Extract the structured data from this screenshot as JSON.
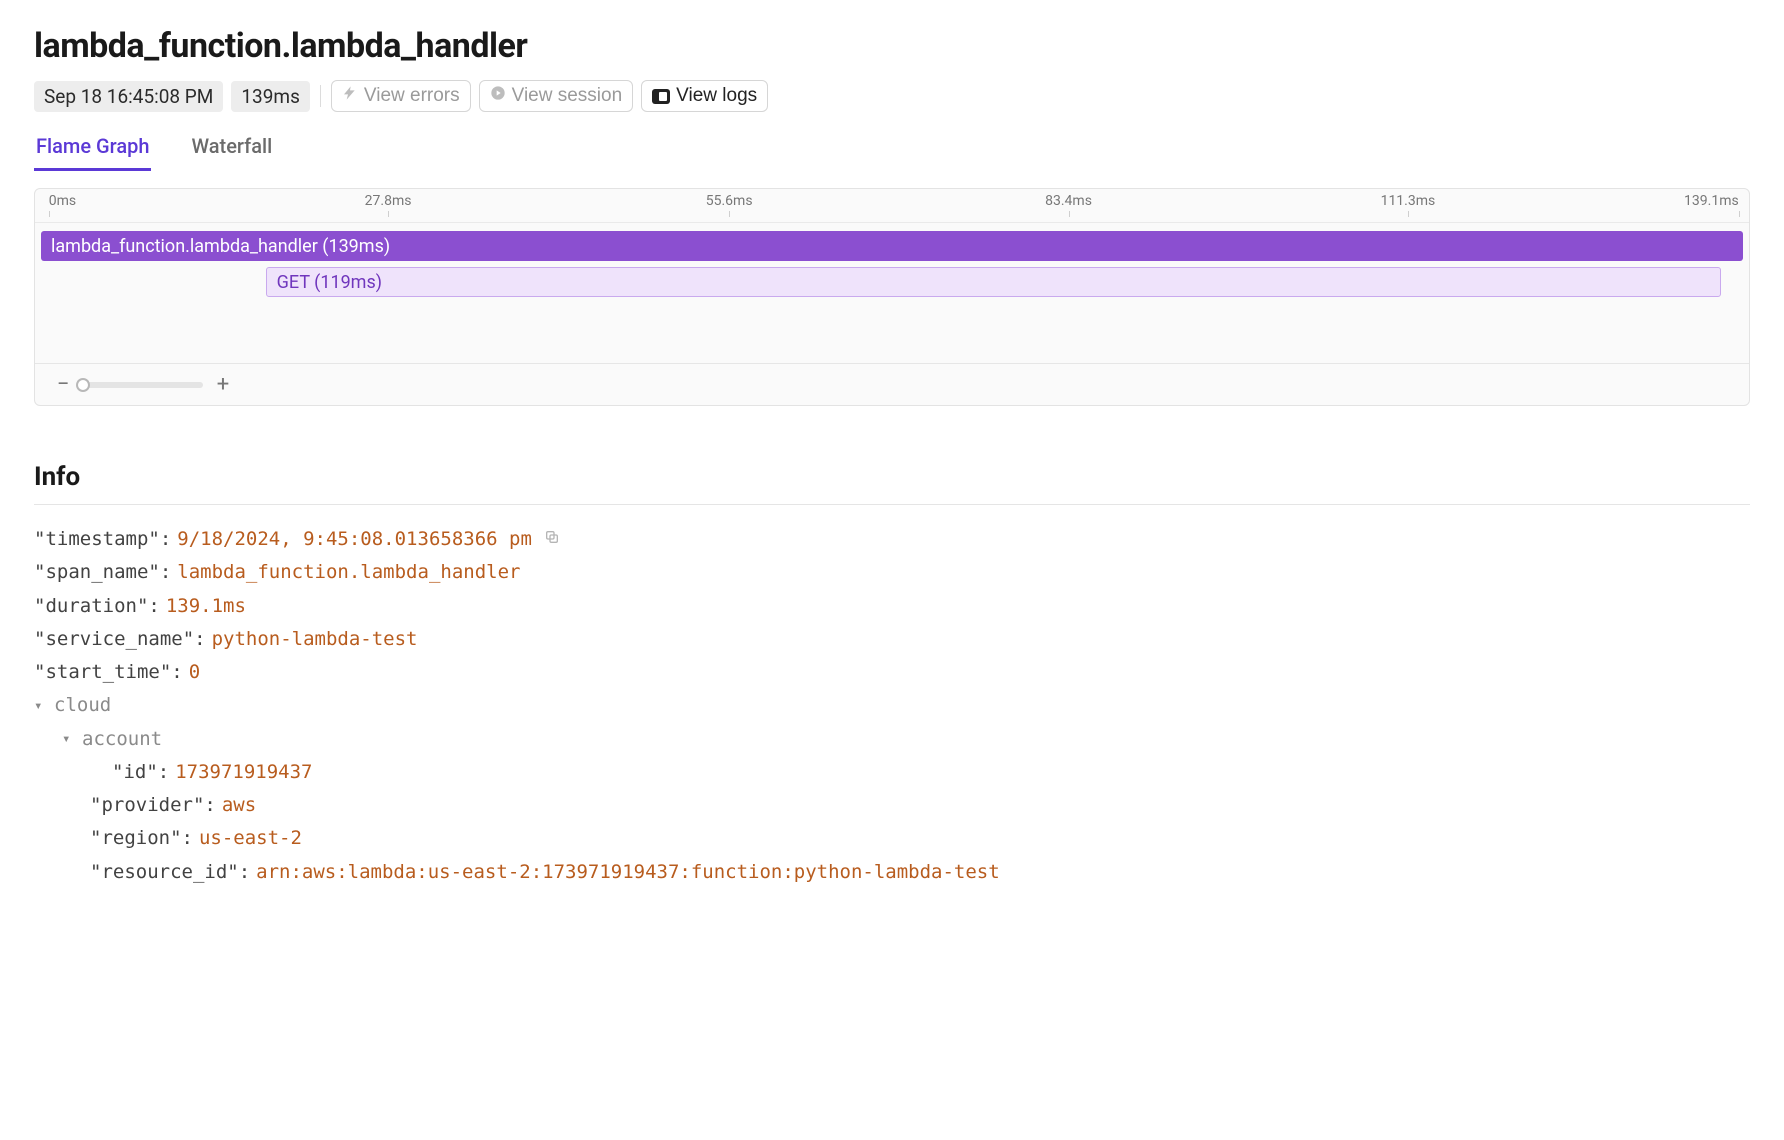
{
  "title": "lambda_function.lambda_handler",
  "header": {
    "timestamp_chip": "Sep 18 16:45:08 PM",
    "duration_chip": "139ms",
    "view_errors": "View errors",
    "view_session": "View session",
    "view_logs": "View logs"
  },
  "tabs": {
    "flame": "Flame Graph",
    "waterfall": "Waterfall"
  },
  "timeline_ticks": [
    "0ms",
    "27.8ms",
    "55.6ms",
    "83.4ms",
    "111.3ms",
    "139.1ms"
  ],
  "flame": {
    "root_label": "lambda_function.lambda_handler (139ms)",
    "child_label": "GET (119ms)"
  },
  "info_heading": "Info",
  "info": {
    "timestamp_key": "\"timestamp\":",
    "timestamp_val": "9/18/2024, 9:45:08.013658366 pm",
    "span_name_key": "\"span_name\":",
    "span_name_val": "lambda_function.lambda_handler",
    "duration_key": "\"duration\":",
    "duration_val": "139.1ms",
    "service_name_key": "\"service_name\":",
    "service_name_val": "python-lambda-test",
    "start_time_key": "\"start_time\":",
    "start_time_val": "0",
    "cloud_label": "cloud",
    "account_label": "account",
    "account_id_key": "\"id\":",
    "account_id_val": "173971919437",
    "provider_key": "\"provider\":",
    "provider_val": "aws",
    "region_key": "\"region\":",
    "region_val": "us-east-2",
    "resource_id_key": "\"resource_id\":",
    "resource_id_val": "arn:aws:lambda:us-east-2:173971919437:function:python-lambda-test"
  },
  "chart_data": {
    "type": "flamegraph",
    "time_unit": "ms",
    "x_range": [
      0,
      139.1
    ],
    "ticks": [
      0,
      27.8,
      55.6,
      83.4,
      111.3,
      139.1
    ],
    "spans": [
      {
        "name": "lambda_function.lambda_handler",
        "start": 0,
        "duration": 139,
        "depth": 0
      },
      {
        "name": "GET",
        "start": 18.3,
        "duration": 119,
        "depth": 1
      }
    ]
  }
}
